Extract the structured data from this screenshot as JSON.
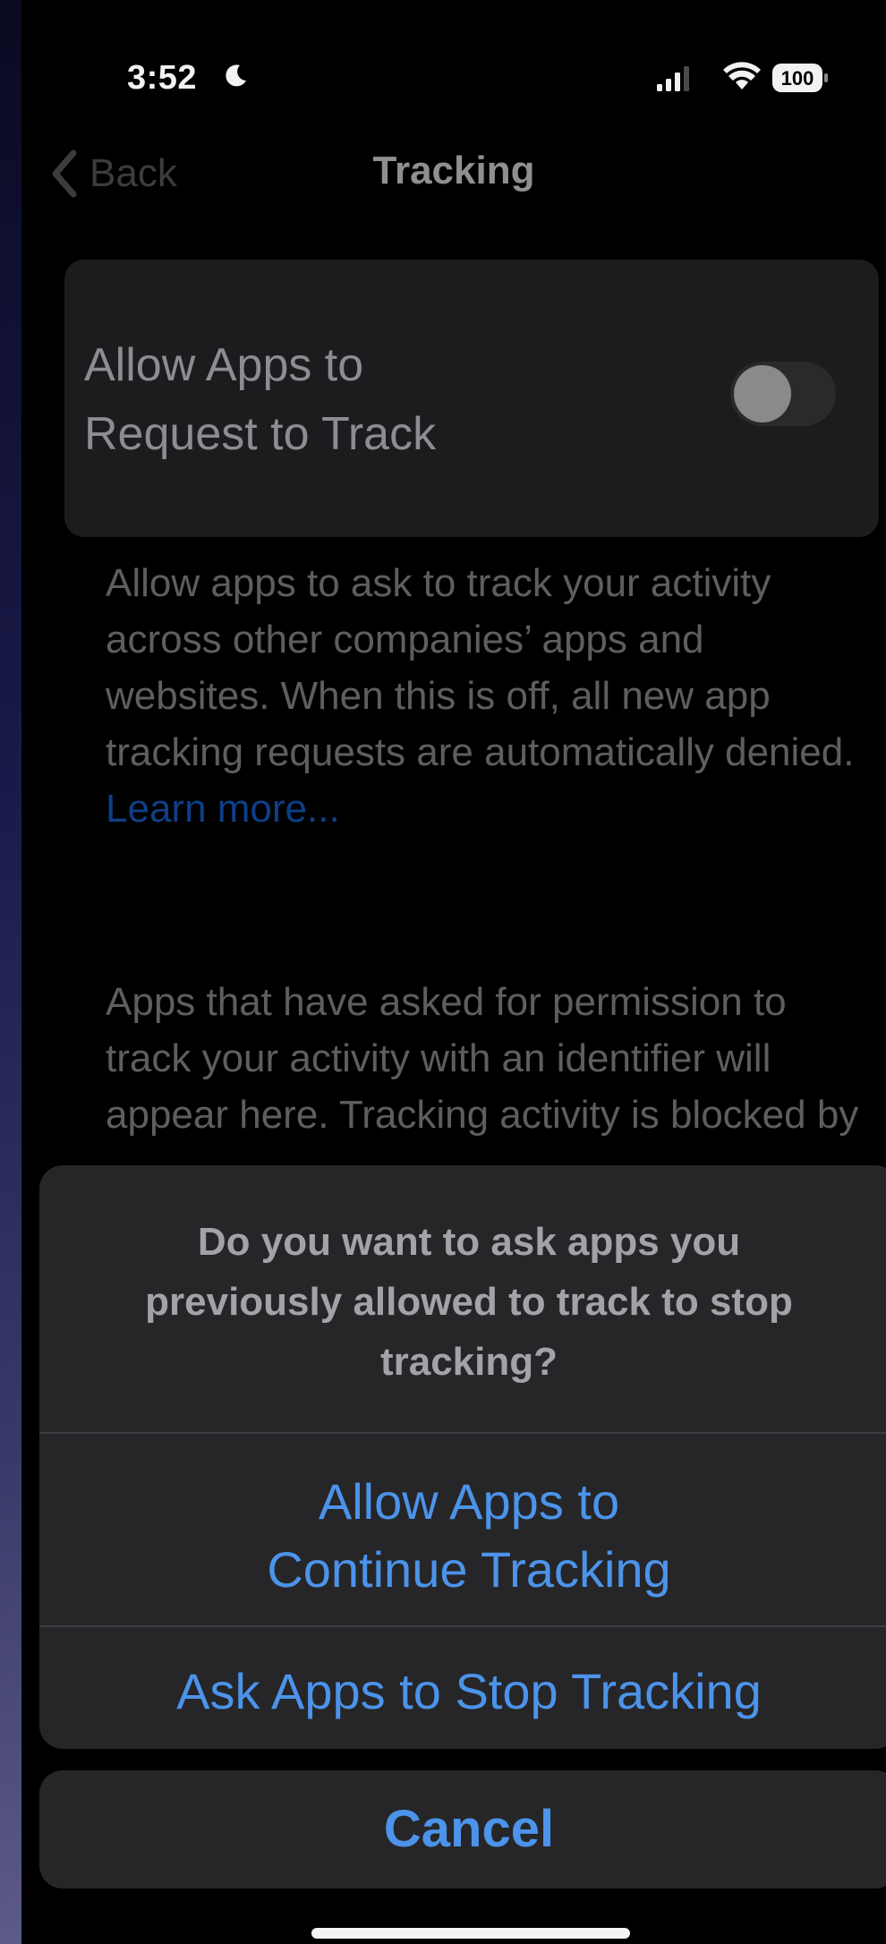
{
  "status_bar": {
    "time": "3:52",
    "battery": "100",
    "icons": [
      "moon-icon",
      "signal-icon",
      "wifi-icon",
      "battery-icon"
    ]
  },
  "nav": {
    "back_label": "Back",
    "title": "Tracking",
    "back_icon": "chevron-left-icon"
  },
  "settings": {
    "toggle_label_line1": "Allow Apps to",
    "toggle_label_line2": "Request to Track",
    "toggle_on": false,
    "footer_description": "Allow apps to ask to track your activity across other companies’ apps and websites. When this is off, all new app tracking requests are automatically denied.",
    "learn_more_label": "Learn more...",
    "apps_footer": "Apps that have asked for permission to track your activity with an identifier will appear here. Tracking activity is blocked by"
  },
  "action_sheet": {
    "message_line1": "Do you want to ask apps you",
    "message_line2": "previously allowed to track to stop",
    "message_line3": "tracking?",
    "continue_line1": "Allow Apps to",
    "continue_line2": "Continue Tracking",
    "stop_label": "Ask Apps to Stop Tracking",
    "cancel_label": "Cancel"
  },
  "colors": {
    "accent": "#4c93ea",
    "sheet_background": "#262628",
    "card_background": "#1c1c1e"
  }
}
